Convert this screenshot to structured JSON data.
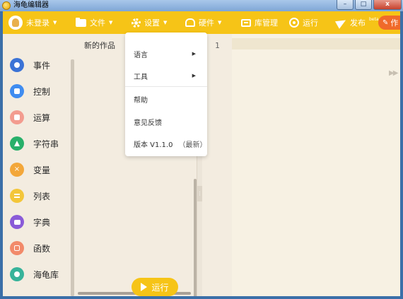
{
  "window": {
    "title": "海龟编辑器",
    "buttons": {
      "minimize": "–",
      "maximize": "□",
      "close": "x"
    }
  },
  "toolbar": {
    "login": "未登录",
    "file": "文件",
    "settings": "设置",
    "hardware": "硬件",
    "library": "库管理",
    "run": "运行",
    "publish": "发布",
    "publish_sup": "beta",
    "create": "作",
    "accent_color": "#f6c417"
  },
  "sidebar": {
    "categories": [
      {
        "label": "事件",
        "icon": "event-icon",
        "color": "#3b73d6"
      },
      {
        "label": "控制",
        "icon": "control-icon",
        "color": "#3f8cf0"
      },
      {
        "label": "运算",
        "icon": "operator-icon",
        "color": "#f39c8f"
      },
      {
        "label": "字符串",
        "icon": "string-icon",
        "color": "#28b06a"
      },
      {
        "label": "变量",
        "icon": "variable-icon",
        "color": "#f3a73a"
      },
      {
        "label": "列表",
        "icon": "list-icon",
        "color": "#f3c63a"
      },
      {
        "label": "字典",
        "icon": "dict-icon",
        "color": "#8a5bd8"
      },
      {
        "label": "函数",
        "icon": "function-icon",
        "color": "#f28a6a"
      },
      {
        "label": "海龟库",
        "icon": "turtle-icon",
        "color": "#37b39a"
      }
    ]
  },
  "workspace": {
    "title": "新的作品",
    "run_button": "运行"
  },
  "editor": {
    "line_numbers": [
      "1"
    ]
  },
  "settings_menu": {
    "items": [
      {
        "label": "语言",
        "has_submenu": true
      },
      {
        "label": "工具",
        "has_submenu": true
      },
      {
        "label": "帮助",
        "has_submenu": false
      },
      {
        "label": "意见反馈",
        "has_submenu": false
      },
      {
        "label": "版本 V1.1.0",
        "tag": "（最新）",
        "has_submenu": false
      }
    ]
  }
}
